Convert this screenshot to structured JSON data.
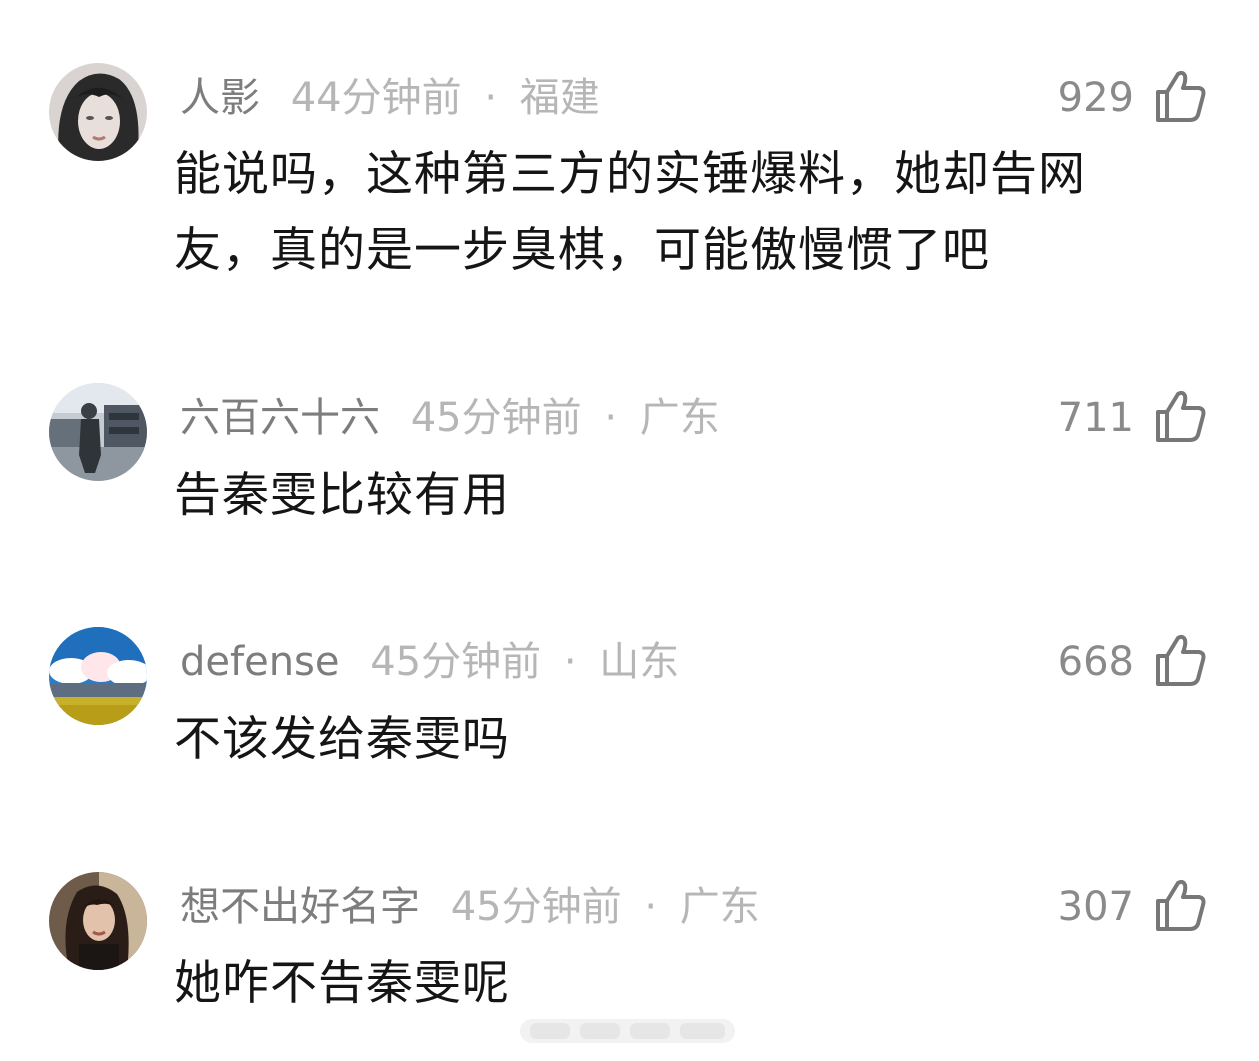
{
  "comments": [
    {
      "username": "人影",
      "time": "44分钟前",
      "separator": "·",
      "location": "福建",
      "likes": "929",
      "text": "能说吗，这种第三方的实锤爆料，她却告网友，真的是一步臭棋，可能傲慢惯了吧"
    },
    {
      "username": "六百六十六",
      "time": "45分钟前",
      "separator": "·",
      "location": "广东",
      "likes": "711",
      "text": "告秦雯比较有用"
    },
    {
      "username": "defense",
      "time": "45分钟前",
      "separator": "·",
      "location": "山东",
      "likes": "668",
      "text": "不该发给秦雯吗"
    },
    {
      "username": "想不出好名字",
      "time": "45分钟前",
      "separator": "·",
      "location": "广东",
      "likes": "307",
      "text": "她咋不告秦雯呢"
    }
  ],
  "icons": {
    "like": "thumbs-up-icon"
  },
  "colors": {
    "username": "#7d7d7d",
    "meta": "#b6b6b6",
    "likes": "#8a8a8a",
    "text": "#151515"
  }
}
